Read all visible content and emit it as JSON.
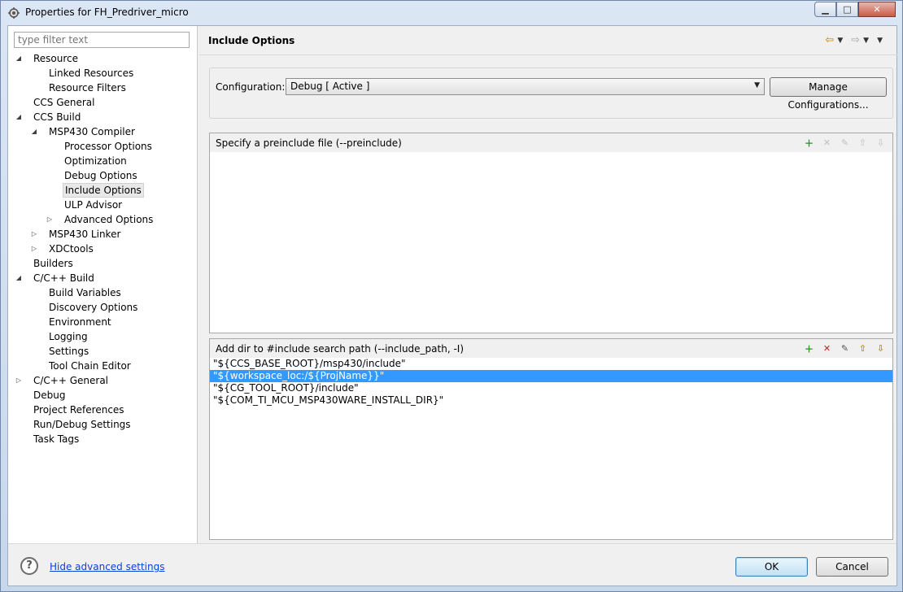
{
  "window": {
    "title": "Properties for FH_Predriver_micro",
    "minimize_glyph": "▁",
    "maximize_glyph": "□",
    "close_glyph": "✕"
  },
  "filter": {
    "placeholder": "type filter text"
  },
  "tree": [
    {
      "label": "Resource",
      "expanded": true,
      "level": 0
    },
    {
      "label": "Linked Resources",
      "level": 1
    },
    {
      "label": "Resource Filters",
      "level": 1
    },
    {
      "label": "CCS General",
      "level": 0
    },
    {
      "label": "CCS Build",
      "expanded": true,
      "level": 0
    },
    {
      "label": "MSP430 Compiler",
      "expanded": true,
      "level": 1
    },
    {
      "label": "Processor Options",
      "level": 2
    },
    {
      "label": "Optimization",
      "level": 2
    },
    {
      "label": "Debug Options",
      "level": 2
    },
    {
      "label": "Include Options",
      "level": 2,
      "selected": true
    },
    {
      "label": "ULP Advisor",
      "level": 2
    },
    {
      "label": "Advanced Options",
      "collapsed": true,
      "level": 2
    },
    {
      "label": "MSP430 Linker",
      "collapsed": true,
      "level": 1
    },
    {
      "label": "XDCtools",
      "collapsed": true,
      "level": 1
    },
    {
      "label": "Builders",
      "level": 0
    },
    {
      "label": "C/C++ Build",
      "expanded": true,
      "level": 0
    },
    {
      "label": "Build Variables",
      "level": 1
    },
    {
      "label": "Discovery Options",
      "level": 1
    },
    {
      "label": "Environment",
      "level": 1
    },
    {
      "label": "Logging",
      "level": 1
    },
    {
      "label": "Settings",
      "level": 1
    },
    {
      "label": "Tool Chain Editor",
      "level": 1
    },
    {
      "label": "C/C++ General",
      "collapsed": true,
      "level": 0
    },
    {
      "label": "Debug",
      "level": 0
    },
    {
      "label": "Project References",
      "level": 0
    },
    {
      "label": "Run/Debug Settings",
      "level": 0
    },
    {
      "label": "Task Tags",
      "level": 0
    }
  ],
  "page": {
    "title": "Include Options",
    "nav": {
      "back": "⇦",
      "forward": "⇨",
      "dropdown": "▼",
      "menu": "▼"
    }
  },
  "config": {
    "label": "Configuration:",
    "value": "Debug  [ Active ]",
    "manage_button": "Manage Configurations..."
  },
  "preinclude": {
    "title": "Specify a preinclude file (--preinclude)",
    "items": []
  },
  "include_path": {
    "title": "Add dir to #include search path (--include_path, -I)",
    "items": [
      "\"${CCS_BASE_ROOT}/msp430/include\"",
      "\"${workspace_loc:/${ProjName}}\"",
      "\"${CG_TOOL_ROOT}/include\"",
      "\"${COM_TI_MCU_MSP430WARE_INSTALL_DIR}\""
    ],
    "selected_index": 1
  },
  "tool_icons": {
    "add": "add-icon",
    "delete": "delete-icon",
    "edit": "edit-icon",
    "move_up": "move-up-icon",
    "move_down": "move-down-icon"
  },
  "footer": {
    "help_glyph": "?",
    "advanced_link": "Hide advanced settings",
    "ok": "OK",
    "cancel": "Cancel"
  },
  "colors": {
    "selection": "#3399ff",
    "link": "#0046d5"
  }
}
